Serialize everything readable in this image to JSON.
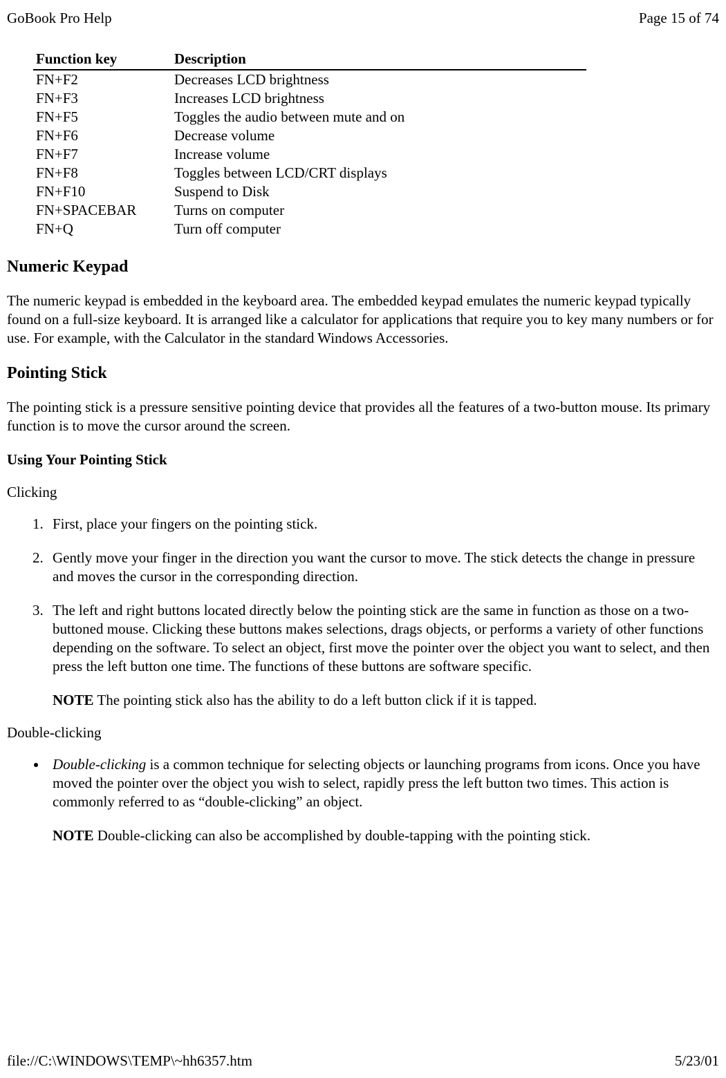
{
  "header": {
    "title": "GoBook Pro Help",
    "page_info": "Page 15 of 74"
  },
  "table": {
    "col1_header": "Function key",
    "col2_header": "Description",
    "rows": [
      {
        "key": "FN+F2",
        "desc": "Decreases LCD brightness"
      },
      {
        "key": "FN+F3",
        "desc": "Increases LCD brightness"
      },
      {
        "key": "FN+F5",
        "desc": "Toggles the audio between mute and on"
      },
      {
        "key": "FN+F6",
        "desc": "Decrease volume"
      },
      {
        "key": "FN+F7",
        "desc": "Increase volume"
      },
      {
        "key": "FN+F8",
        "desc": "Toggles between LCD/CRT displays"
      },
      {
        "key": "FN+F10",
        "desc": "Suspend to Disk"
      },
      {
        "key": "FN+SPACEBAR",
        "desc": "Turns on computer"
      },
      {
        "key": "FN+Q",
        "desc": "Turn off computer"
      }
    ]
  },
  "sections": {
    "numeric_keypad": {
      "heading": "Numeric Keypad",
      "text": "The numeric keypad is embedded in the keyboard area. The embedded keypad emulates the numeric keypad typically found on a full-size keyboard. It is arranged like a calculator for applications that require you to key many numbers or for use.  For example,  with the Calculator in the standard Windows Accessories."
    },
    "pointing_stick": {
      "heading": "Pointing Stick",
      "text": "The pointing stick is a pressure sensitive pointing device that provides all the features of a two-button mouse. Its primary function is to move the cursor around the screen.",
      "using_heading": "Using Your Pointing Stick",
      "clicking_label": "Clicking",
      "steps": [
        "First, place your fingers on the pointing stick.",
        "Gently move your finger in the direction you want the cursor to move. The stick detects the change in pressure and moves the cursor in the corresponding direction.",
        "The left and right buttons located directly below the pointing stick are the same in function as those on a two-buttoned mouse. Clicking these buttons makes selections, drags objects, or performs a variety of other functions depending on the software. To select an object, first move the pointer over the object you want to select, and then press the left button one time. The functions of these buttons are software specific."
      ],
      "note1_label": "NOTE",
      "note1_text": "  The pointing stick also has the ability to do a left button click if it is tapped.",
      "double_clicking_label": "Double-clicking",
      "double_click_term": "Double-clicking",
      "double_click_text": " is a common technique for selecting objects or launching programs from icons. Once you have moved the pointer over the object you wish to select, rapidly press the left button two times. This action is commonly referred to as “double-clicking” an object.",
      "note2_label": "NOTE",
      "note2_text": "  Double-clicking can also be accomplished by double-tapping with the pointing stick."
    }
  },
  "footer": {
    "path": "file://C:\\WINDOWS\\TEMP\\~hh6357.htm",
    "date": "5/23/01"
  }
}
